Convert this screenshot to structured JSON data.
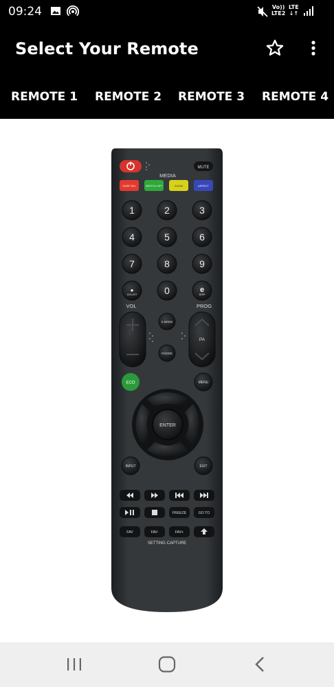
{
  "status_bar": {
    "time": "09:24",
    "network_top": "Vo))",
    "network_bottom": "LTE2",
    "lte_label": "LTE",
    "icons": [
      "image-icon",
      "hotspot-icon",
      "mute-icon",
      "data-arrows-icon",
      "signal-icon"
    ]
  },
  "app_bar": {
    "title": "Select Your Remote",
    "star_icon": "star-outline-icon",
    "more_icon": "more-vert-icon"
  },
  "tabs": [
    {
      "label": "REMOTE 1"
    },
    {
      "label": "REMOTE 2"
    },
    {
      "label": "REMOTE 3"
    },
    {
      "label": "REMOTE 4"
    }
  ],
  "remote": {
    "top_labels": {
      "mute": "MUTE",
      "media": "MEDIA"
    },
    "color_keys": [
      "SLEEP DEL",
      "SUBTITLE LOPT",
      "ZOOM",
      "ASPECT"
    ],
    "digits": [
      "1",
      "2",
      "3",
      "4",
      "5",
      "6",
      "7",
      "8",
      "9",
      "0"
    ],
    "digit_side_labels": {
      "left": "CH.LIST",
      "right": "DISP"
    },
    "vol_label": "VOL",
    "prog_label": "PROG",
    "smode": "S.MODE",
    "pmode": "P.MODE",
    "pa": "PA",
    "eco": "ECO",
    "menu": "MENU",
    "enter": "ENTER",
    "input": "INPUT",
    "exit": "EXIT",
    "transport_row2": [
      "FREEZE",
      "GO TO"
    ],
    "fav_row": [
      "FAV",
      "FAV-",
      "FAV+"
    ],
    "setting_capture": "SETTING CAPTURE",
    "colors": {
      "body": "#2b2e30",
      "key": "#1a1c1e",
      "power": "#d8332b",
      "red": "#e23a2e",
      "green": "#2fa83a",
      "yellow": "#d6d21c",
      "blue": "#3848b8",
      "eco": "#2a9a3a"
    }
  },
  "nav_bar": {
    "icons": [
      "recents-icon",
      "home-icon",
      "back-icon"
    ]
  }
}
